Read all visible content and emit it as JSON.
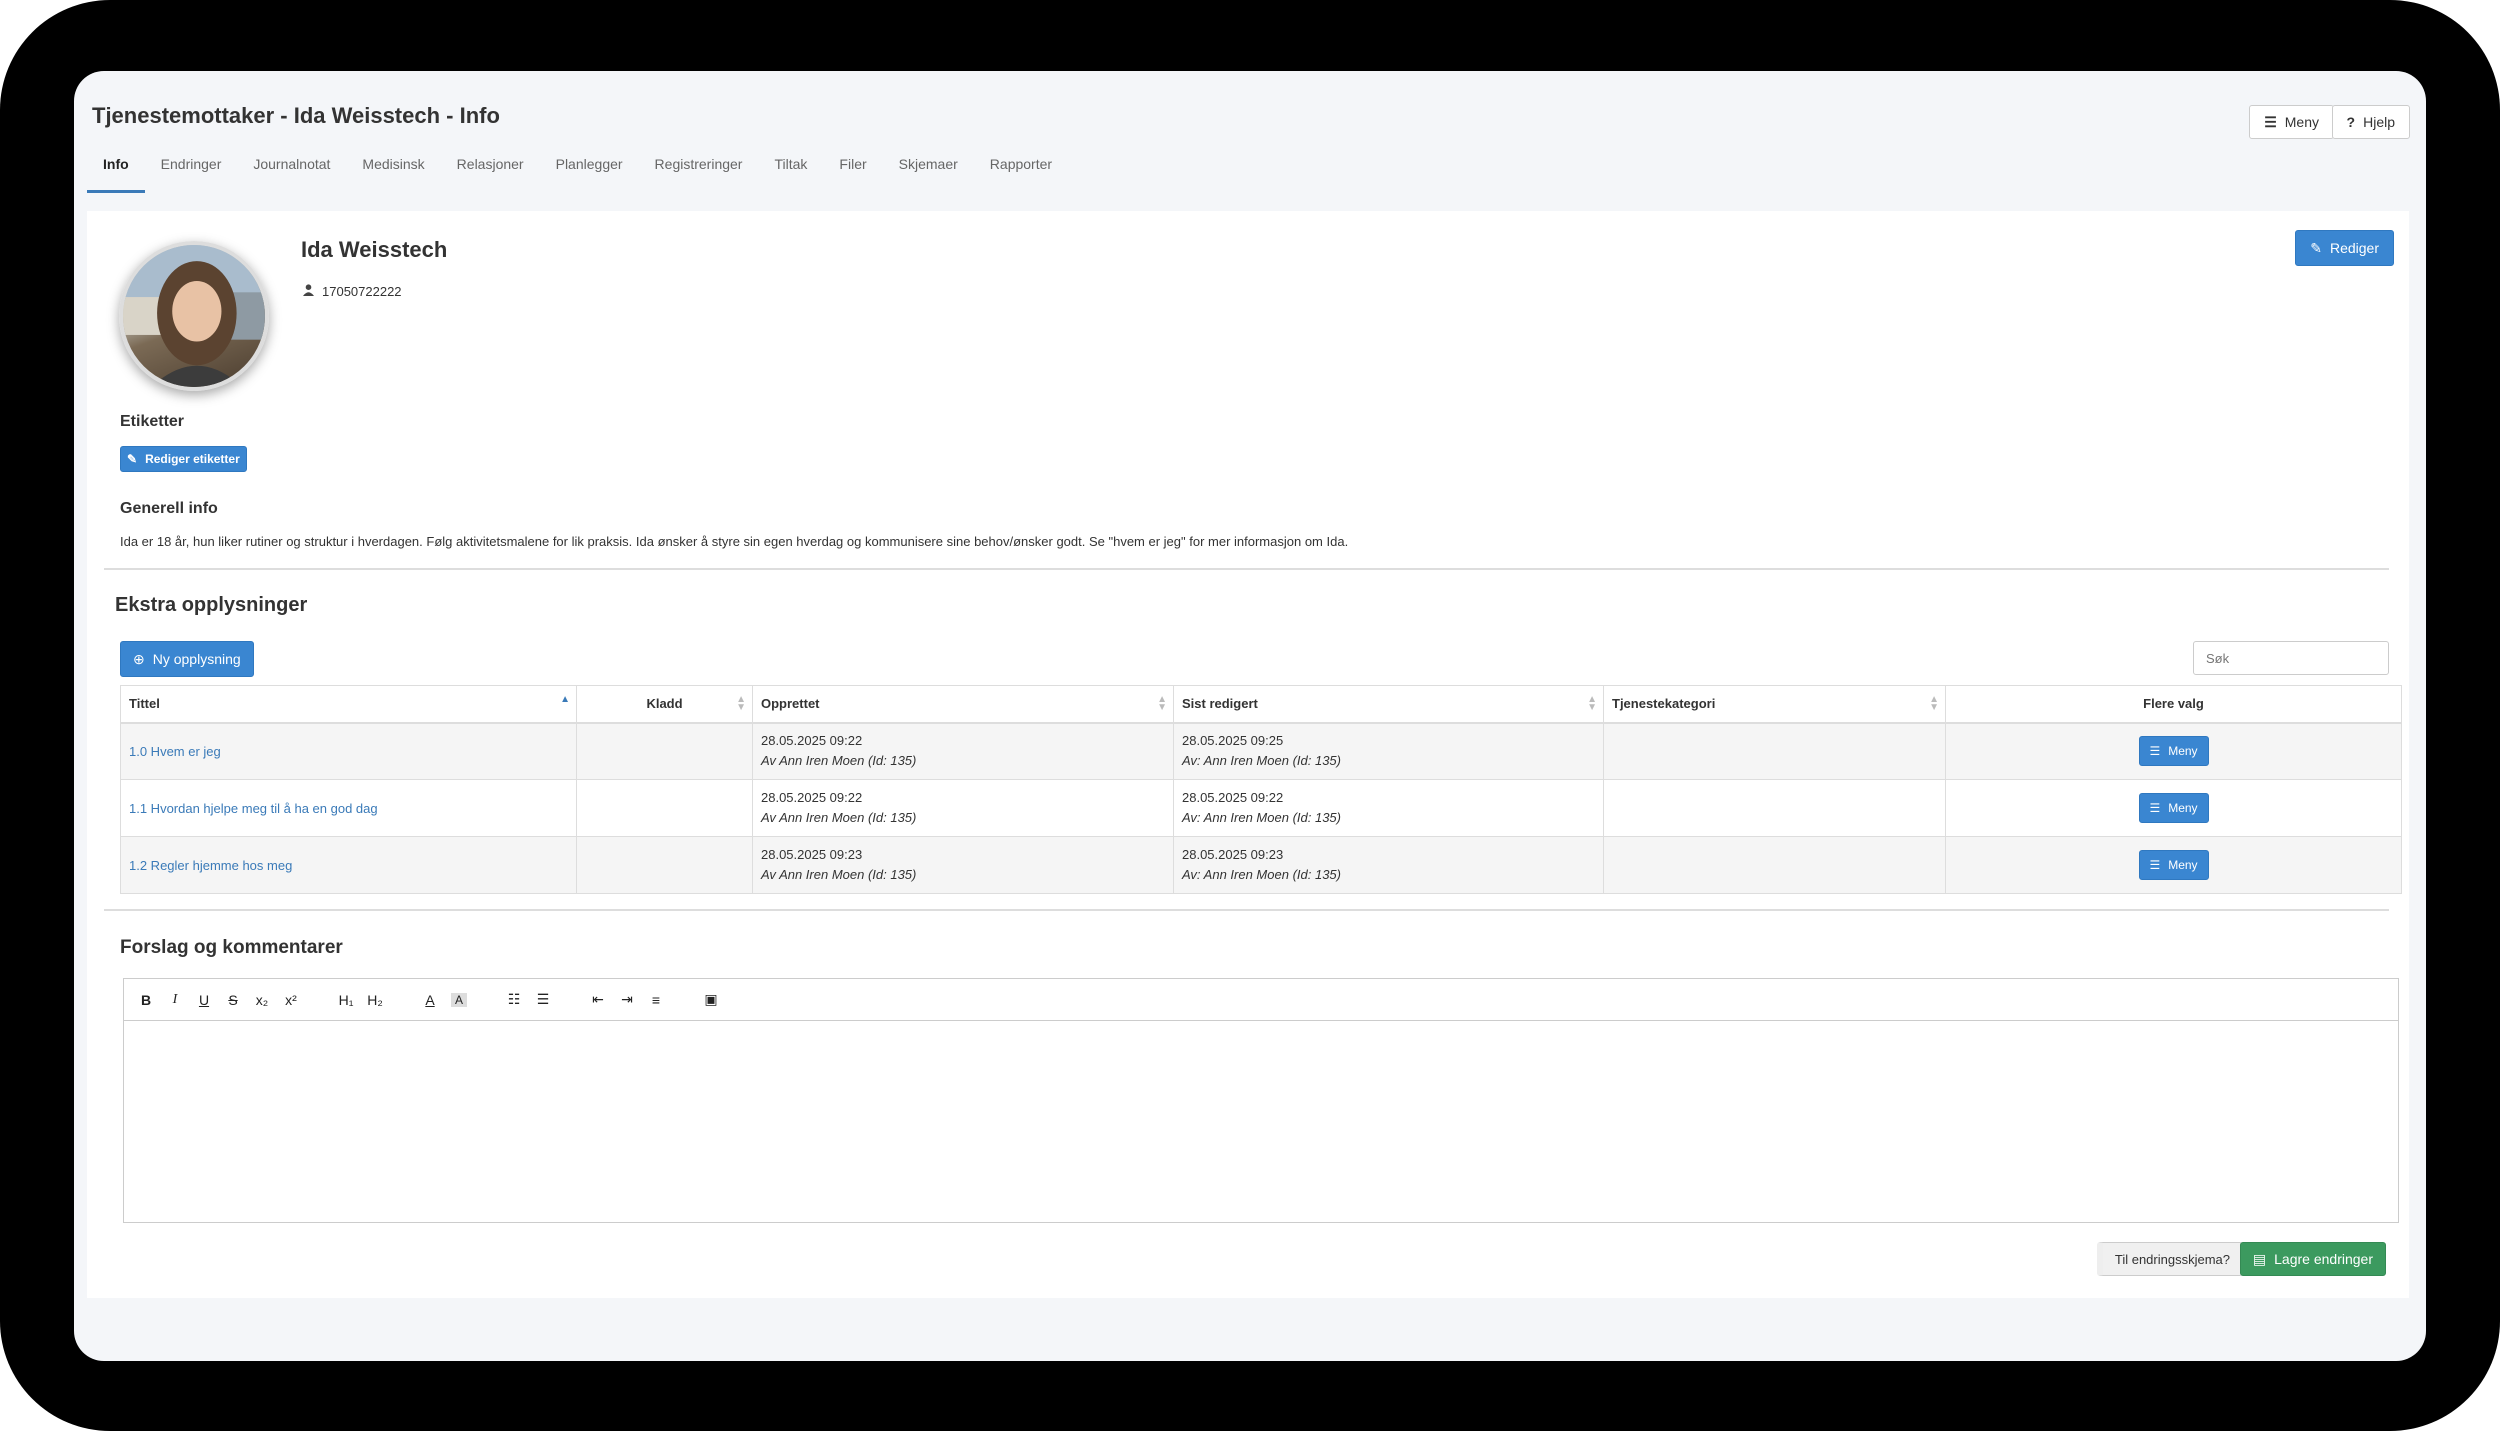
{
  "header": {
    "title": "Tjenestemottaker - Ida Weisstech - Info",
    "menu_label": "Meny",
    "help_label": "Hjelp"
  },
  "tabs": [
    {
      "label": "Info",
      "active": true
    },
    {
      "label": "Endringer"
    },
    {
      "label": "Journalnotat"
    },
    {
      "label": "Medisinsk"
    },
    {
      "label": "Relasjoner"
    },
    {
      "label": "Planlegger"
    },
    {
      "label": "Registreringer"
    },
    {
      "label": "Tiltak"
    },
    {
      "label": "Filer"
    },
    {
      "label": "Skjemaer"
    },
    {
      "label": "Rapporter"
    }
  ],
  "profile": {
    "name": "Ida Weisstech",
    "id_number": "17050722222",
    "edit_label": "Rediger"
  },
  "tags": {
    "heading": "Etiketter",
    "edit_label": "Rediger etiketter"
  },
  "general": {
    "heading": "Generell info",
    "text": "Ida er 18 år, hun liker rutiner og struktur i hverdagen. Følg aktivitetsmalene for lik praksis. Ida ønsker å styre sin egen hverdag og kommunisere sine behov/ønsker godt. Se \"hvem er jeg\" for mer informasjon om Ida."
  },
  "extra": {
    "heading": "Ekstra opplysninger",
    "new_label": "Ny opplysning",
    "search_placeholder": "Søk",
    "columns": [
      "Tittel",
      "Kladd",
      "Opprettet",
      "Sist redigert",
      "Tjenestekategori",
      "Flere valg"
    ],
    "rows": [
      {
        "title": "1.0 Hvem er jeg",
        "draft": "",
        "created_date": "28.05.2025 09:22",
        "created_by": "Av Ann Iren Moen (Id: 135)",
        "edited_date": "28.05.2025 09:25",
        "edited_by": "Av: Ann Iren Moen (Id: 135)",
        "category": "",
        "menu_label": "Meny"
      },
      {
        "title": "1.1 Hvordan hjelpe meg til å ha en god dag",
        "draft": "",
        "created_date": "28.05.2025 09:22",
        "created_by": "Av Ann Iren Moen (Id: 135)",
        "edited_date": "28.05.2025 09:22",
        "edited_by": "Av: Ann Iren Moen (Id: 135)",
        "category": "",
        "menu_label": "Meny"
      },
      {
        "title": "1.2 Regler hjemme hos meg",
        "draft": "",
        "created_date": "28.05.2025 09:23",
        "created_by": "Av Ann Iren Moen (Id: 135)",
        "edited_date": "28.05.2025 09:23",
        "edited_by": "Av: Ann Iren Moen (Id: 135)",
        "category": "",
        "menu_label": "Meny"
      }
    ]
  },
  "comments": {
    "heading": "Forslag og kommentarer",
    "toolbar": {
      "bold": "B",
      "italic": "I",
      "underline": "U",
      "strike": "S",
      "subscript": "x₂",
      "superscript": "x²",
      "h1": "H₁",
      "h2": "H₂",
      "font_color": "A",
      "bg_color": "A"
    }
  },
  "footer": {
    "change_form_label": "Til endringsskjema?",
    "save_label": "Lagre endringer"
  },
  "colors": {
    "primary": "#3a86d1",
    "success": "#3c9a5f",
    "link": "#3a7ab8"
  }
}
